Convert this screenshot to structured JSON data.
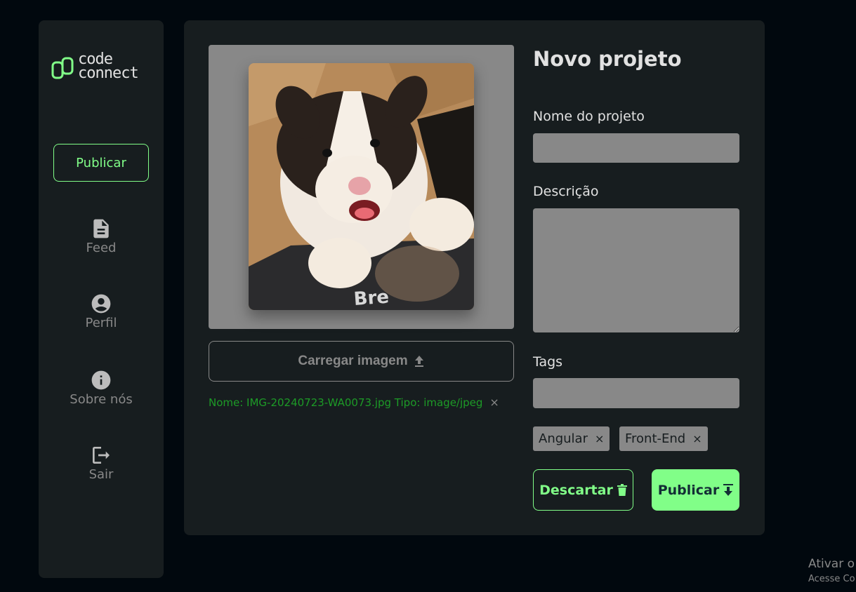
{
  "brand": {
    "line1": "code",
    "line2": "connect",
    "accent": "#81fe88"
  },
  "sidebar": {
    "publish_label": "Publicar",
    "items": [
      {
        "label": "Feed",
        "icon": "document-icon"
      },
      {
        "label": "Perfil",
        "icon": "account-circle-icon"
      },
      {
        "label": "Sobre nós",
        "icon": "info-icon"
      },
      {
        "label": "Sair",
        "icon": "logout-icon"
      }
    ]
  },
  "upload": {
    "button_label": "Carregar imagem",
    "file_info": "Nome: IMG-20240723-WA0073.jpg Tipo: image/jpeg",
    "remove_icon": "×"
  },
  "form": {
    "title": "Novo projeto",
    "name_label": "Nome do projeto",
    "name_value": "",
    "description_label": "Descrição",
    "description_value": "",
    "tags_label": "Tags",
    "tags_value": "",
    "tags": [
      "Angular",
      "Front-End"
    ],
    "tag_remove": "×",
    "discard_label": "Descartar",
    "publish_label": "Publicar"
  },
  "watermark": {
    "line1": "Ativar o",
    "line2": "Acesse Co"
  }
}
